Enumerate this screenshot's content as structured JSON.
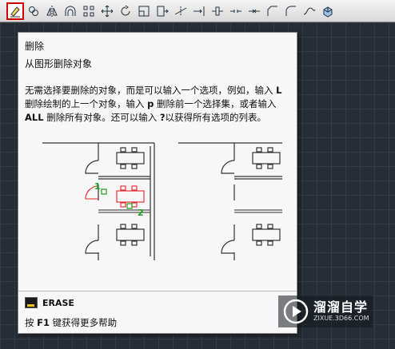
{
  "toolbar": {
    "tools": [
      {
        "name": "erase-tool",
        "icon": "eraser-icon",
        "active": true
      },
      {
        "name": "copy-tool",
        "icon": "copy-icon"
      },
      {
        "name": "mirror-tool",
        "icon": "mirror-icon"
      },
      {
        "name": "offset-tool",
        "icon": "offset-icon"
      },
      {
        "name": "array-tool",
        "icon": "array-icon"
      },
      {
        "name": "move-tool",
        "icon": "move-icon"
      },
      {
        "name": "rotate-tool",
        "icon": "rotate-icon"
      },
      {
        "name": "scale-tool",
        "icon": "scale-icon"
      },
      {
        "name": "stretch-tool",
        "icon": "stretch-icon"
      },
      {
        "name": "trim-tool",
        "icon": "trim-icon"
      },
      {
        "name": "extend-tool",
        "icon": "extend-icon"
      },
      {
        "name": "break-at-point-tool",
        "icon": "break-at-point-icon"
      },
      {
        "name": "break-tool",
        "icon": "break-icon"
      },
      {
        "name": "join-tool",
        "icon": "join-icon"
      },
      {
        "name": "chamfer-tool",
        "icon": "chamfer-icon"
      },
      {
        "name": "fillet-tool",
        "icon": "fillet-icon"
      },
      {
        "name": "blend-tool",
        "icon": "blend-icon"
      },
      {
        "name": "explode-tool",
        "icon": "explode-icon"
      }
    ]
  },
  "tooltip": {
    "title": "删除",
    "summary": "从图形删除对象",
    "desc_1": "无需选择要删除的对象，而是可以输入一个选项，例如，输入 ",
    "key_l": "L",
    "desc_2": "删除绘制的上一个对象，输入 ",
    "key_p": "p",
    "desc_3": " 删除前一个选择集，或者输入",
    "key_all": "ALL",
    "desc_4": " 删除所有对象。还可以输入 ",
    "key_q": "?",
    "desc_5": "以获得所有选项的列表。",
    "label_1": "1",
    "label_2": "2",
    "command_name": "ERASE",
    "help_prefix": "按 ",
    "help_key": "F1",
    "help_suffix": " 键获得更多帮助"
  },
  "watermark": {
    "name": "溜溜自学",
    "url": "ZIXUE.3D66.COM"
  },
  "colors": {
    "accent_red": "#d20000",
    "selection_red": "#e8202a",
    "label_green": "#1aa31a"
  }
}
